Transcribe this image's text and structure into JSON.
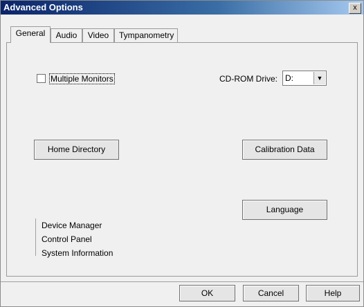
{
  "window": {
    "title": "Advanced Options",
    "close_label": "x"
  },
  "tabs": [
    {
      "label": "General",
      "active": true
    },
    {
      "label": "Audio",
      "active": false
    },
    {
      "label": "Video",
      "active": false
    },
    {
      "label": "Tympanometry",
      "active": false
    }
  ],
  "general": {
    "multiple_monitors_label": "Multiple Monitors",
    "multiple_monitors_checked": false,
    "cdrom_label": "CD-ROM Drive:",
    "cdrom_value": "D:",
    "home_directory_label": "Home Directory",
    "calibration_data_label": "Calibration Data",
    "language_label": "Language",
    "links": [
      "Device Manager",
      "Control Panel",
      "System Information"
    ]
  },
  "footer": {
    "ok_label": "OK",
    "cancel_label": "Cancel",
    "help_label": "Help"
  }
}
